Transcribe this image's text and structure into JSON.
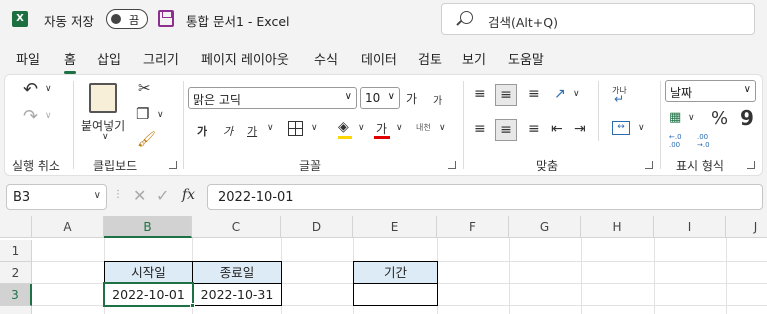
{
  "titlebar": {
    "autosave_label": "자동 저장",
    "autosave_state": "끔",
    "doc_title": "통합 문서1  -  Excel",
    "search_placeholder": "검색(Alt+Q)"
  },
  "menu": [
    "파일",
    "홈",
    "삽입",
    "그리기",
    "페이지 레이아웃",
    "수식",
    "데이터",
    "검토",
    "보기",
    "도움말"
  ],
  "ribbon": {
    "undo_group_label": "실행 취소",
    "clipboard_group_label": "클립보드",
    "paste_label": "붙여넣기",
    "font_group_label": "글꼴",
    "font_name": "맑은 고딕",
    "font_size": "10",
    "grow_font": "가",
    "shrink_font": "가",
    "bold": "가",
    "italic": "가",
    "underline": "가",
    "font_color": "가",
    "phonetic": "내천",
    "alignment_group_label": "맞춤",
    "wrap_label": "가나",
    "number_group_label": "표시 형식",
    "number_format": "날짜",
    "percent": "%",
    "comma": "9",
    "inc_decimal": "←.0 .00",
    "dec_decimal": ".00 →.0"
  },
  "formula_bar": {
    "name_box": "B3",
    "fx": "fx",
    "formula": "2022-10-01"
  },
  "sheet": {
    "columns": [
      "A",
      "B",
      "C",
      "D",
      "E",
      "F",
      "G",
      "H",
      "I",
      "J"
    ],
    "rows": [
      "1",
      "2",
      "3"
    ],
    "b2": "시작일",
    "c2": "종료일",
    "e2": "기간",
    "b3": "2022-10-01",
    "c3": "2022-10-31",
    "e3": ""
  },
  "colors": {
    "accent": "#1e7145",
    "header_fill": "#ddebf7"
  }
}
